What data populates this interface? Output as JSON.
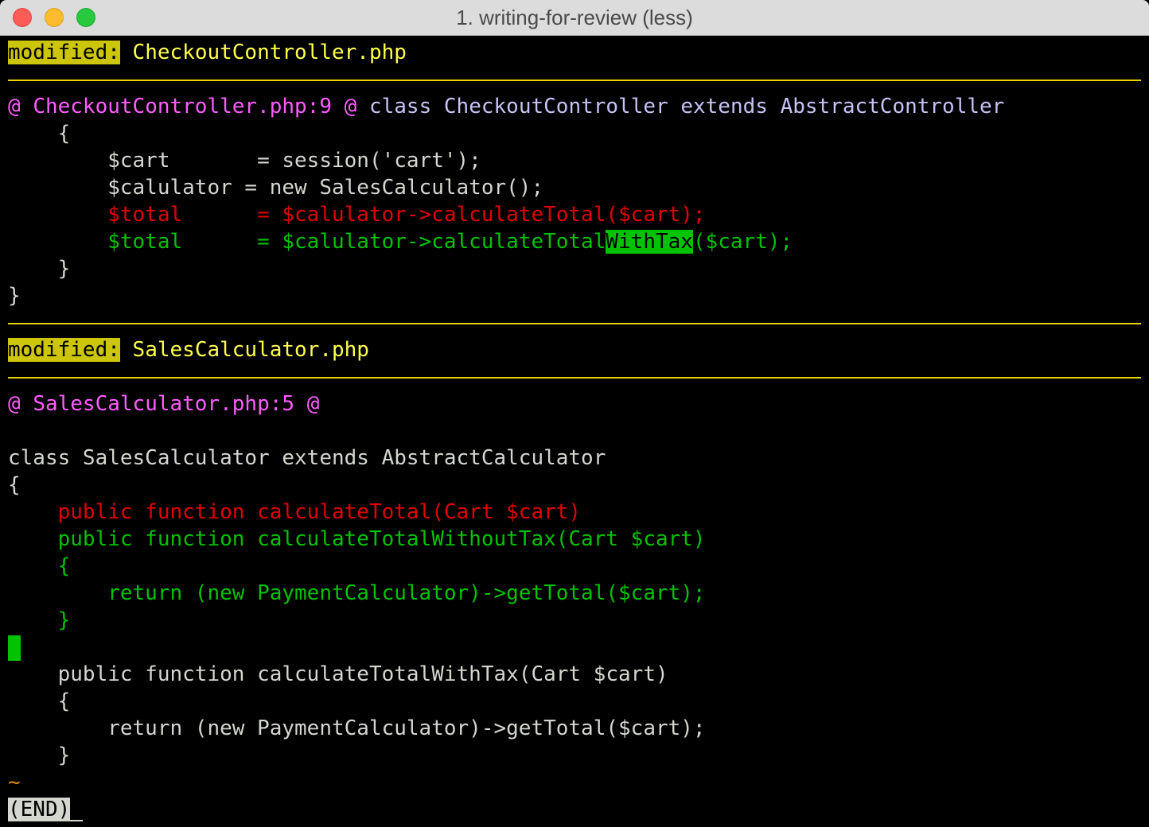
{
  "window": {
    "title": "1. writing-for-review (less)"
  },
  "file1": {
    "status": "modified:",
    "name": "CheckoutController.php",
    "hunk": {
      "marker_l": "@",
      "location": "CheckoutController.php:9",
      "marker_r": "@",
      "kw_class": "class",
      "class_name": "CheckoutController",
      "kw_extends": "extends",
      "parent": "AbstractController"
    },
    "lines": [
      "    {",
      "        $cart       = session('cart');",
      "        $calulator = new SalesCalculator();",
      "        $total      = $calulator->calculateTotal($cart);",
      "        $total      = $calulator->calculateTotal",
      "WithTax",
      "($cart);",
      "    }",
      "}"
    ]
  },
  "file2": {
    "status": "modified:",
    "name": "SalesCalculator.php",
    "hunk": {
      "marker_l": "@",
      "location": "SalesCalculator.php:5",
      "marker_r": "@"
    },
    "lines": [
      "class SalesCalculator extends AbstractCalculator",
      "{",
      "    public function calculateTotal(Cart $cart)",
      "    public function calculateTotalWithoutTax(Cart $cart)",
      "    {",
      "        return (new PaymentCalculator)->getTotal($cart);",
      "    }",
      "    public function calculateTotalWithTax(Cart $cart)",
      "    {",
      "        return (new PaymentCalculator)->getTotal($cart);",
      "    }"
    ]
  },
  "footer": {
    "tilde": "~",
    "end_label": "(END)"
  },
  "colors": {
    "removed": "#e00000",
    "added": "#00c200",
    "header_tag": "#cdc50a",
    "filename": "#ffff4c",
    "hunk": "#ff5cff"
  }
}
